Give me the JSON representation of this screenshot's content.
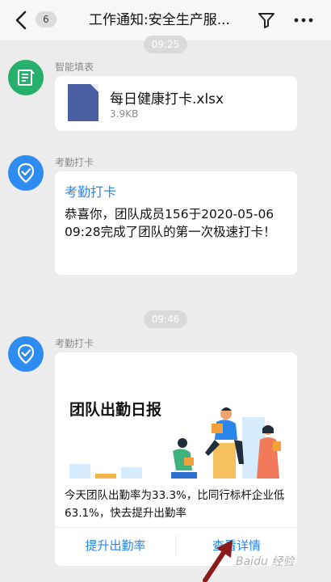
{
  "header": {
    "badge": "6",
    "title": "工作通知:安全生产服..."
  },
  "times": {
    "top": "09:25",
    "middle": "09:46"
  },
  "messages": {
    "form": {
      "sender": "智能填表",
      "file_name": "每日健康打卡.xlsx",
      "file_size": "3.9KB"
    },
    "attendance1": {
      "sender": "考勤打卡",
      "title": "考勤打卡",
      "text": "恭喜你，团队成员156于2020-05-06 09:28完成了团队的第一次极速打卡！"
    },
    "attendance2": {
      "sender": "考勤打卡",
      "report_title": "团队出勤日报",
      "description": "今天团队出勤率为33.3%，比同行标杆企业低63.1%，快去提升出勤率",
      "action_left": "提升出勤率",
      "action_right": "查看详情"
    }
  },
  "watermark": "Baidu 经验",
  "colors": {
    "accent": "#2a86e8",
    "form_avatar": "#27b06b",
    "attendance_avatar": "#2d8cf0"
  },
  "icons": {
    "back": "chevron-left-icon",
    "filter": "filter-icon",
    "more": "more-icon",
    "form": "form-icon",
    "attendance": "checkin-icon",
    "file": "excel-file-icon"
  }
}
